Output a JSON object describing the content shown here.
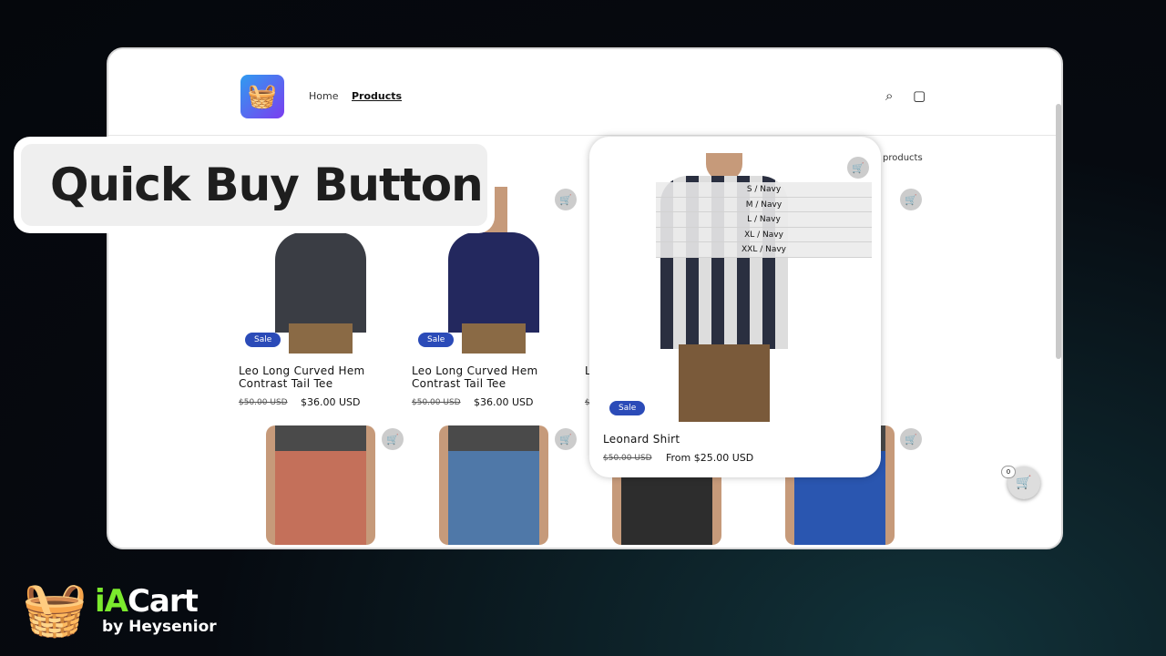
{
  "header": {
    "nav": [
      {
        "label": "Home"
      },
      {
        "label": "Products",
        "active": true
      }
    ],
    "icons": [
      "search-icon",
      "cart-icon"
    ]
  },
  "collection_count_text": "products",
  "products": [
    {
      "title": "Leo Long Curved Hem Contrast Tail Tee",
      "compare_price": "$50.00 USD",
      "price": "$36.00 USD",
      "badge": "Sale",
      "color": "#3a3d44"
    },
    {
      "title": "Leo Long Curved Hem Contrast Tail Tee",
      "compare_price": "$50.00 USD",
      "price": "$36.00 USD",
      "badge": "Sale",
      "color": "#23285e"
    },
    {
      "title": "L",
      "compare_price": "$5",
      "price": "",
      "badge": "",
      "color": "#ccc"
    }
  ],
  "row2_colors": [
    "#c4705a",
    "#4f78a8",
    "#2d2d2d",
    "#2a56b0"
  ],
  "quick_buy": {
    "title": "Leonard Shirt",
    "compare_price": "$50.00 USD",
    "price": "From $25.00 USD",
    "badge": "Sale",
    "variants": [
      "S / Navy",
      "M / Navy",
      "L / Navy",
      "XL / Navy",
      "XXL / Navy"
    ]
  },
  "overlay_label": "Quick Buy Button",
  "floating_cart": {
    "count": "0"
  },
  "brand": {
    "name_a": "iA",
    "name_b": "Cart",
    "tagline": "by Heysenior"
  },
  "colors": {
    "sale_badge": "#2b4bb8",
    "brand_green": "#7bea2d"
  }
}
